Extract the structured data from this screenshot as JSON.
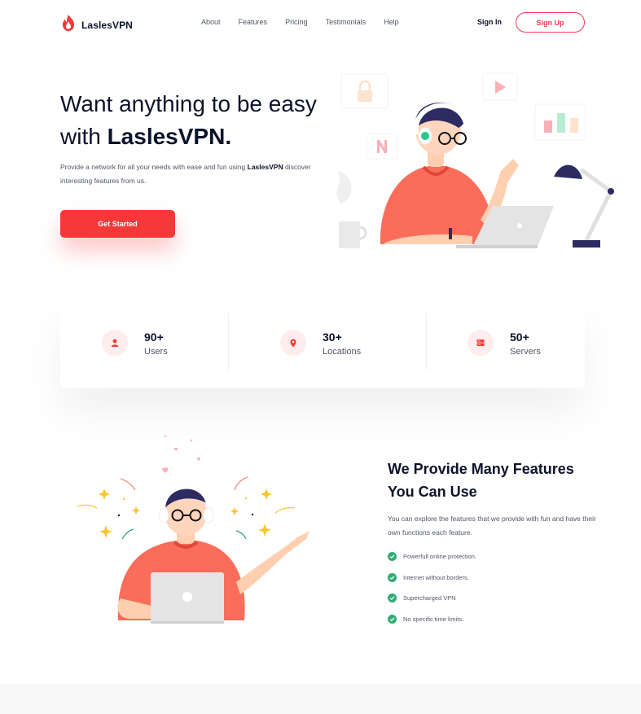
{
  "brand": {
    "name": "LaslesVPN",
    "accent": "#f53838"
  },
  "nav": {
    "items": [
      "About",
      "Features",
      "Pricing",
      "Testimonials",
      "Help"
    ],
    "signin": "Sign In",
    "signup": "Sign Up"
  },
  "hero": {
    "title_part1": "Want anything to be easy with ",
    "title_brand": "LaslesVPN.",
    "desc_part1": "Provide a network for all your needs with ease and fun using ",
    "desc_brand": "LaslesVPN",
    "desc_part2": " discover interesting features from us.",
    "cta": "Get Started",
    "illustration_icons": [
      "lock-icon",
      "netflix-icon",
      "play-icon",
      "bar-chart-icon",
      "coffee-mug-icon",
      "desk-lamp-icon",
      "laptop-icon"
    ]
  },
  "stats": [
    {
      "value": "90+",
      "label": "Users",
      "icon": "user-icon"
    },
    {
      "value": "30+",
      "label": "Locations",
      "icon": "location-pin-icon"
    },
    {
      "value": "50+",
      "label": "Servers",
      "icon": "server-icon"
    }
  ],
  "features": {
    "title": "We Provide Many Features You Can Use",
    "desc": "You can explore the features that we provide with fun and have their own functions each feature.",
    "items": [
      "Powerfull online protection.",
      "Internet without borders.",
      "Supercharged VPN",
      "No specific time limits."
    ]
  }
}
